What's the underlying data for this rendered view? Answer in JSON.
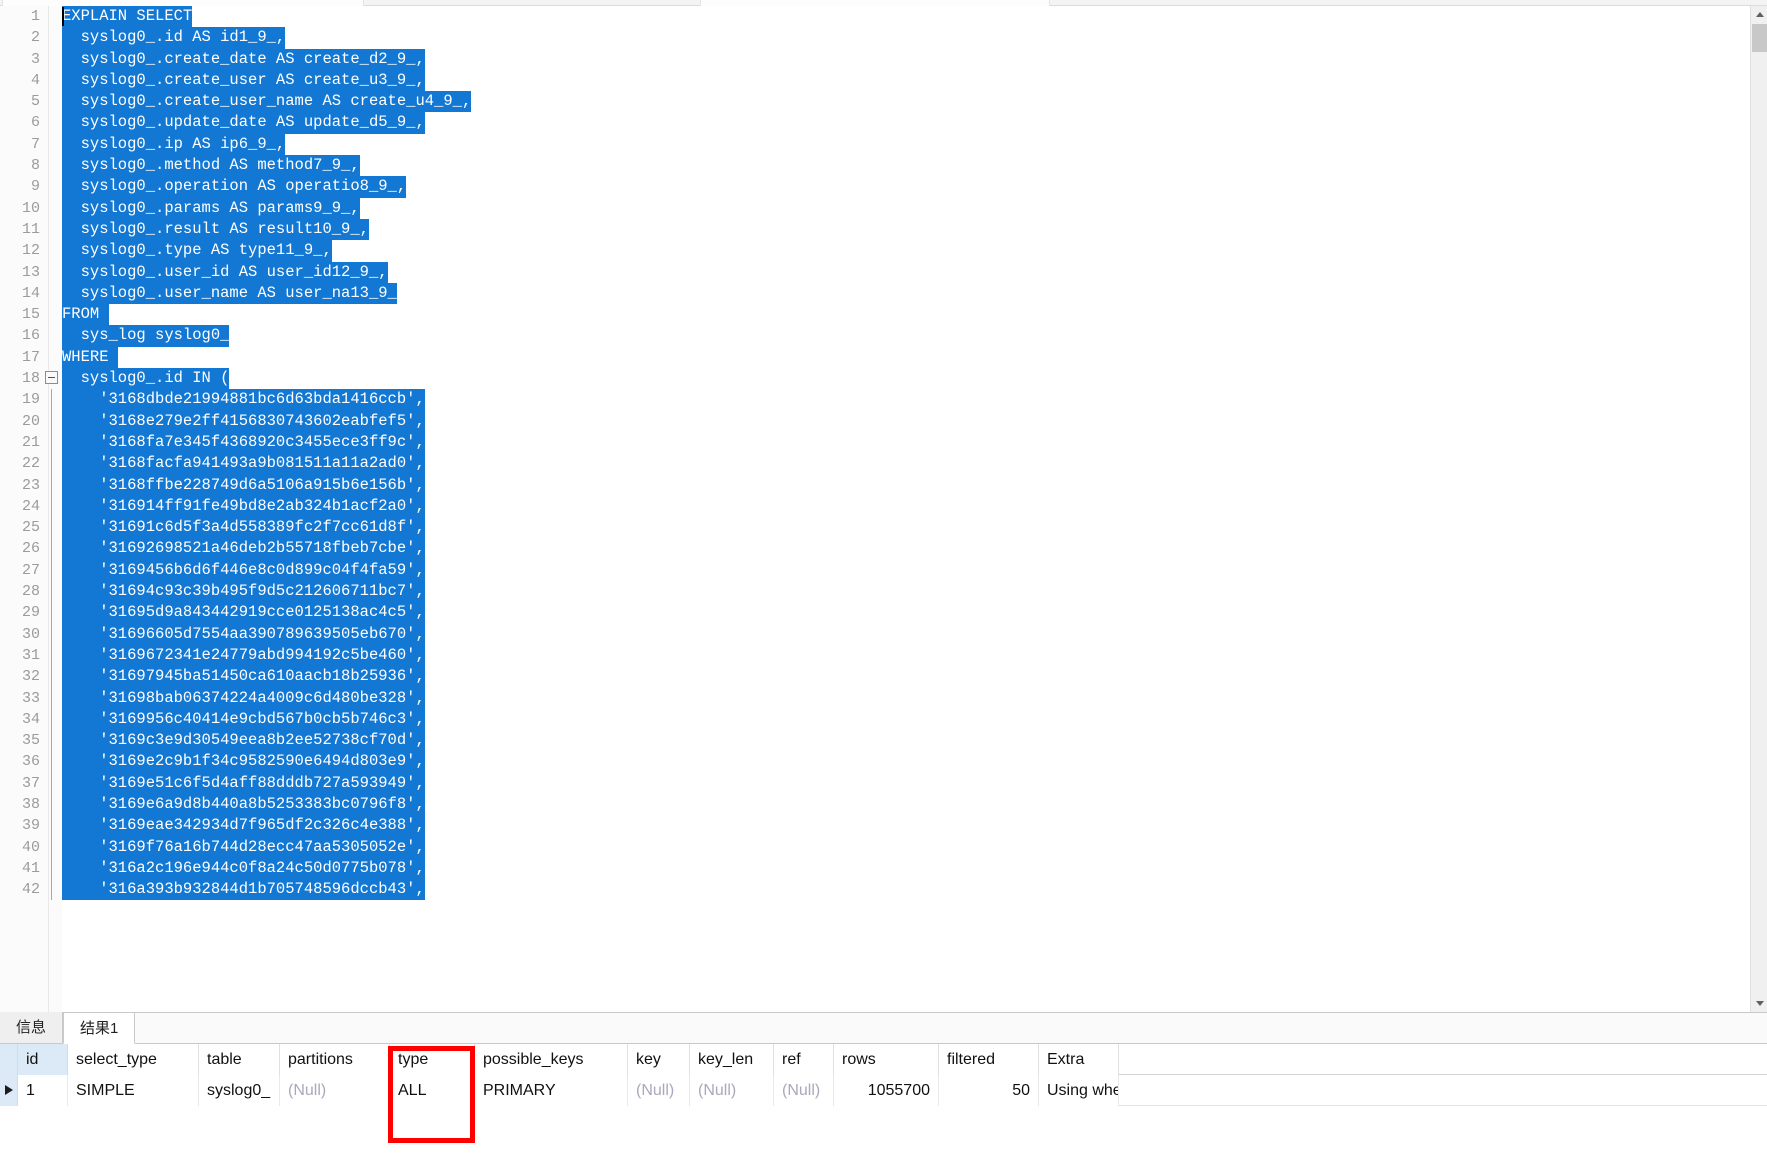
{
  "editor": {
    "lines": [
      {
        "n": 1,
        "sel": "EXPLAIN SELECT",
        "caret": true
      },
      {
        "n": 2,
        "sel": "  syslog0_.id AS id1_9_,"
      },
      {
        "n": 3,
        "sel": "  syslog0_.create_date AS create_d2_9_,"
      },
      {
        "n": 4,
        "sel": "  syslog0_.create_user AS create_u3_9_,"
      },
      {
        "n": 5,
        "sel": "  syslog0_.create_user_name AS create_u4_9_,"
      },
      {
        "n": 6,
        "sel": "  syslog0_.update_date AS update_d5_9_,"
      },
      {
        "n": 7,
        "sel": "  syslog0_.ip AS ip6_9_,"
      },
      {
        "n": 8,
        "sel": "  syslog0_.method AS method7_9_,"
      },
      {
        "n": 9,
        "sel": "  syslog0_.operation AS operatio8_9_,"
      },
      {
        "n": 10,
        "sel": "  syslog0_.params AS params9_9_,"
      },
      {
        "n": 11,
        "sel": "  syslog0_.result AS result10_9_,"
      },
      {
        "n": 12,
        "sel": "  syslog0_.type AS type11_9_,"
      },
      {
        "n": 13,
        "sel": "  syslog0_.user_id AS user_id12_9_,"
      },
      {
        "n": 14,
        "sel": "  syslog0_.user_name AS user_na13_9_"
      },
      {
        "n": 15,
        "sel": "FROM "
      },
      {
        "n": 16,
        "sel": "  sys_log syslog0_"
      },
      {
        "n": 17,
        "sel": "WHERE "
      },
      {
        "n": 18,
        "sel": "  syslog0_.id IN (",
        "fold": "minus"
      },
      {
        "n": 19,
        "sel": "    '3168dbde21994881bc6d63bda1416ccb',",
        "fold": "line"
      },
      {
        "n": 20,
        "sel": "    '3168e279e2ff4156830743602eabfef5',",
        "fold": "line"
      },
      {
        "n": 21,
        "sel": "    '3168fa7e345f4368920c3455ece3ff9c',",
        "fold": "line"
      },
      {
        "n": 22,
        "sel": "    '3168facfa941493a9b081511a11a2ad0',",
        "fold": "line"
      },
      {
        "n": 23,
        "sel": "    '3168ffbe228749d6a5106a915b6e156b',",
        "fold": "line"
      },
      {
        "n": 24,
        "sel": "    '316914ff91fe49bd8e2ab324b1acf2a0',",
        "fold": "line"
      },
      {
        "n": 25,
        "sel": "    '31691c6d5f3a4d558389fc2f7cc61d8f',",
        "fold": "line"
      },
      {
        "n": 26,
        "sel": "    '31692698521a46deb2b55718fbeb7cbe',",
        "fold": "line"
      },
      {
        "n": 27,
        "sel": "    '3169456b6d6f446e8c0d899c04f4fa59',",
        "fold": "line"
      },
      {
        "n": 28,
        "sel": "    '31694c93c39b495f9d5c212606711bc7',",
        "fold": "line"
      },
      {
        "n": 29,
        "sel": "    '31695d9a843442919cce0125138ac4c5',",
        "fold": "line"
      },
      {
        "n": 30,
        "sel": "    '31696605d7554aa390789639505eb670',",
        "fold": "line"
      },
      {
        "n": 31,
        "sel": "    '3169672341e24779abd994192c5be460',",
        "fold": "line"
      },
      {
        "n": 32,
        "sel": "    '31697945ba51450ca610aacb18b25936',",
        "fold": "line"
      },
      {
        "n": 33,
        "sel": "    '31698bab06374224a4009c6d480be328',",
        "fold": "line"
      },
      {
        "n": 34,
        "sel": "    '3169956c40414e9cbd567b0cb5b746c3',",
        "fold": "line"
      },
      {
        "n": 35,
        "sel": "    '3169c3e9d30549eea8b2ee52738cf70d',",
        "fold": "line"
      },
      {
        "n": 36,
        "sel": "    '3169e2c9b1f34c9582590e6494d803e9',",
        "fold": "line"
      },
      {
        "n": 37,
        "sel": "    '3169e51c6f5d4aff88dddb727a593949',",
        "fold": "line"
      },
      {
        "n": 38,
        "sel": "    '3169e6a9d8b440a8b5253383bc0796f8',",
        "fold": "line"
      },
      {
        "n": 39,
        "sel": "    '3169eae342934d7f965df2c326c4e388',",
        "fold": "line"
      },
      {
        "n": 40,
        "sel": "    '3169f76a16b744d28ecc47aa5305052e',",
        "fold": "line"
      },
      {
        "n": 41,
        "sel": "    '316a2c196e944c0f8a24c50d0775b078',",
        "fold": "line"
      },
      {
        "n": 42,
        "sel": "    '316a393b932844d1b705748596dccb43',",
        "fold": "line"
      }
    ],
    "selection_color": "#1378d3",
    "selection_text_color": "#ffffff"
  },
  "bottom_panel": {
    "tabs": [
      {
        "label": "信息",
        "active": false
      },
      {
        "label": "结果1",
        "active": true
      }
    ],
    "result_grid": {
      "columns": [
        "id",
        "select_type",
        "table",
        "partitions",
        "type",
        "possible_keys",
        "key",
        "key_len",
        "ref",
        "rows",
        "filtered",
        "Extra"
      ],
      "rows": [
        {
          "selected": true,
          "cells": [
            "1",
            "SIMPLE",
            "syslog0_",
            "(Null)",
            "ALL",
            "PRIMARY",
            "(Null)",
            "(Null)",
            "(Null)",
            "1055700",
            "50",
            "Using whe"
          ]
        }
      ],
      "null_label": "(Null)"
    }
  },
  "annotation": {
    "type": "rectangle",
    "color": "#ff0000",
    "target_column": "type",
    "target_value": "ALL"
  },
  "scrollbar": {
    "up_arrow": "scroll-up-icon",
    "down_arrow": "scroll-down-icon",
    "thumb_position_pct": 2
  }
}
